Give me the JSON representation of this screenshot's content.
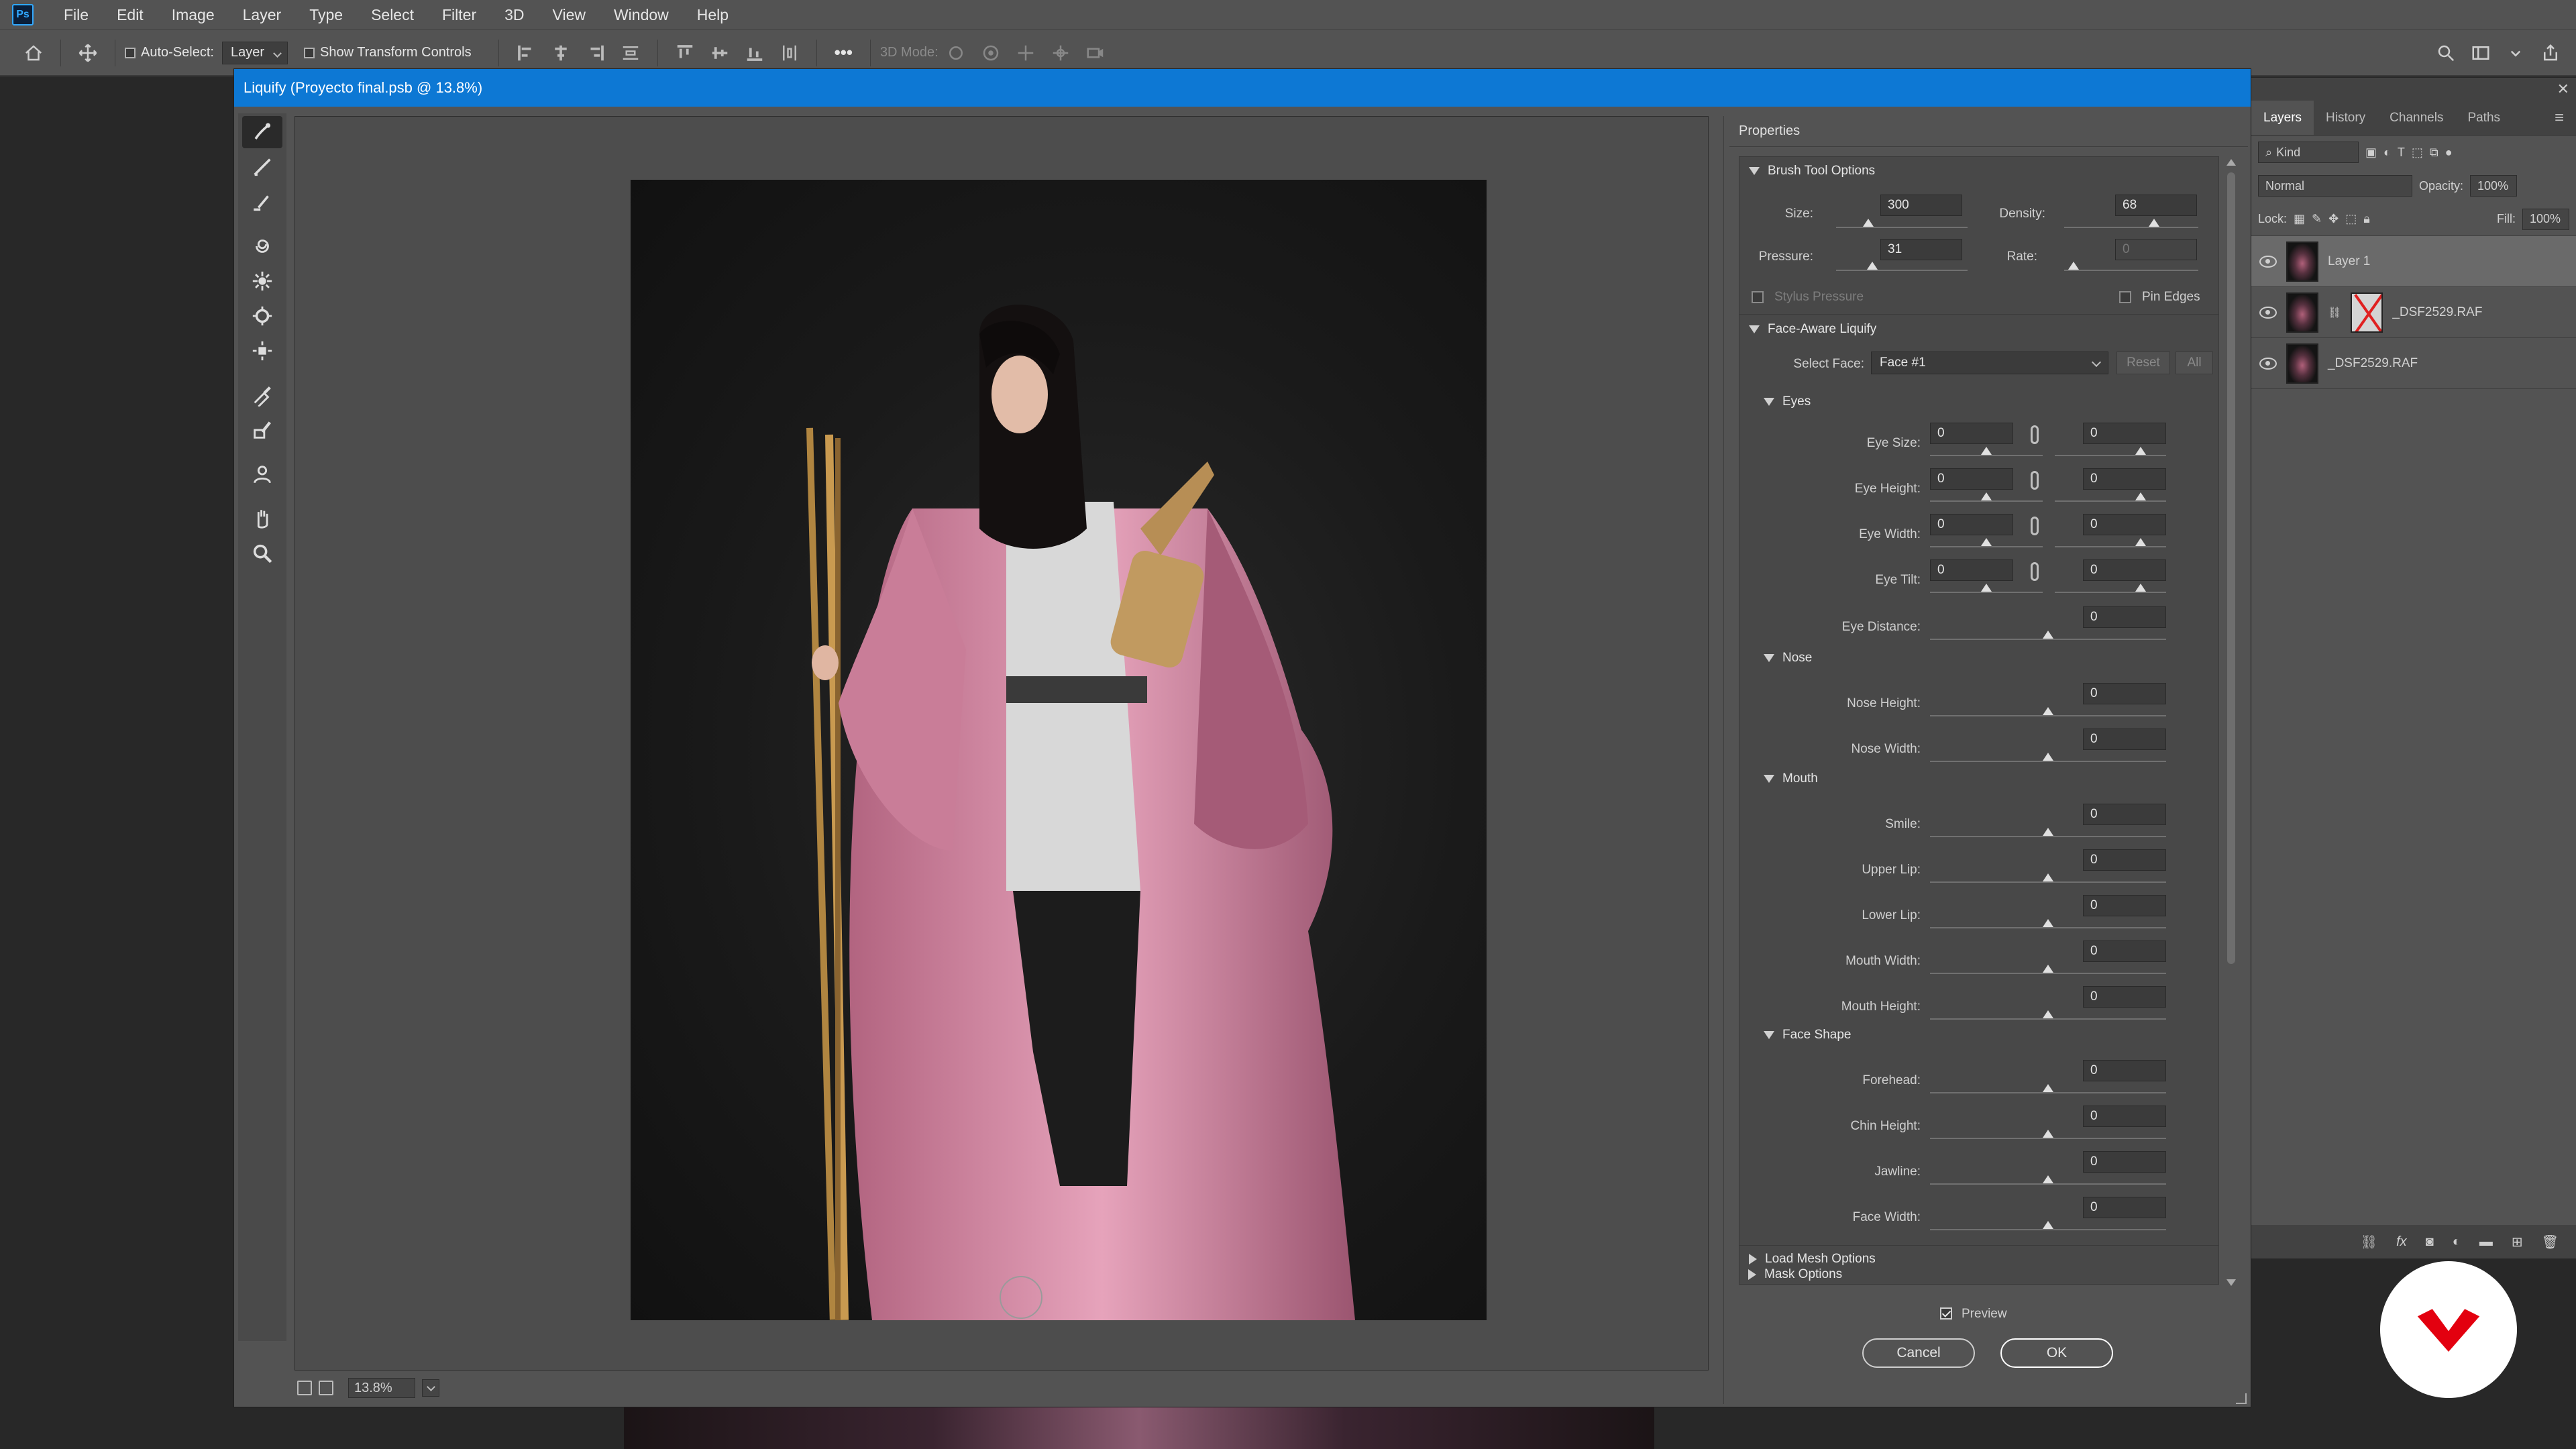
{
  "menubar": {
    "app_logo": "Ps",
    "items": [
      "File",
      "Edit",
      "Image",
      "Layer",
      "Type",
      "Select",
      "Filter",
      "3D",
      "View",
      "Window",
      "Help"
    ]
  },
  "options_bar": {
    "auto_select_label": "Auto-Select:",
    "auto_select_value": "Layer",
    "show_transform_label": "Show Transform Controls",
    "mode_3d_label": "3D Mode:",
    "more_label": "•••"
  },
  "layers_panel": {
    "tabs": [
      "Layers",
      "History",
      "Channels",
      "Paths"
    ],
    "filter_value": "Kind",
    "blend_mode": "Normal",
    "opacity_label": "Opacity:",
    "opacity_value": "100%",
    "lock_label": "Lock:",
    "fill_label": "Fill:",
    "fill_value": "100%",
    "layers": [
      {
        "name": "Layer 1"
      },
      {
        "name": "_DSF2529.RAF"
      },
      {
        "name": "_DSF2529.RAF"
      }
    ],
    "fx_label": "fx"
  },
  "dialog": {
    "title": "Liquify (Proyecto final.psb @ 13.8%)",
    "zoom_value": "13.8%",
    "properties_title": "Properties",
    "brush": {
      "section": "Brush Tool Options",
      "size_label": "Size:",
      "size_value": "300",
      "density_label": "Density:",
      "density_value": "68",
      "pressure_label": "Pressure:",
      "pressure_value": "31",
      "rate_label": "Rate:",
      "rate_value": "0",
      "stylus_label": "Stylus Pressure",
      "pin_edges_label": "Pin Edges"
    },
    "face": {
      "section": "Face-Aware Liquify",
      "select_face_label": "Select Face:",
      "select_face_value": "Face #1",
      "reset_label": "Reset",
      "all_label": "All",
      "eyes_label": "Eyes",
      "eye_size": "Eye Size:",
      "eye_height": "Eye Height:",
      "eye_width": "Eye Width:",
      "eye_tilt": "Eye Tilt:",
      "eye_distance": "Eye Distance:",
      "nose_label": "Nose",
      "nose_height": "Nose Height:",
      "nose_width": "Nose Width:",
      "mouth_label": "Mouth",
      "smile": "Smile:",
      "upper_lip": "Upper Lip:",
      "lower_lip": "Lower Lip:",
      "mouth_width": "Mouth Width:",
      "mouth_height": "Mouth Height:",
      "face_shape_label": "Face Shape",
      "forehead": "Forehead:",
      "chin_height": "Chin Height:",
      "jawline": "Jawline:",
      "face_width": "Face Width:",
      "zero": "0"
    },
    "load_mesh_label": "Load Mesh Options",
    "mask_options_label": "Mask Options",
    "preview_label": "Preview",
    "cancel_label": "Cancel",
    "ok_label": "OK"
  },
  "colors": {
    "accent": "#0d78d4",
    "logo_red": "#e3000f"
  }
}
